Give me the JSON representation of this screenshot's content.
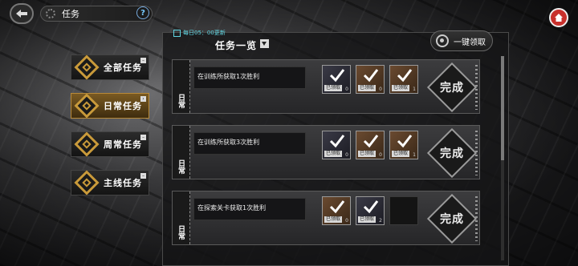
{
  "header": {
    "title": "任务",
    "help_glyph": "?"
  },
  "sidebar": {
    "items": [
      {
        "label": "全部任务",
        "active": false
      },
      {
        "label": "日常任务",
        "active": true
      },
      {
        "label": "周常任务",
        "active": false
      },
      {
        "label": "主线任务",
        "active": false
      }
    ]
  },
  "panel": {
    "refresh_text": "每日05：00更新",
    "title": "任务一览",
    "claim_all_label": "一键领取",
    "card_type": "日常",
    "done_label": "完成",
    "claimed_label": "已领取"
  },
  "tasks": [
    {
      "text": "在训练所获取1次胜利",
      "rewards": [
        {
          "tint": "blue",
          "count": "0"
        },
        {
          "tint": "brown",
          "count": "0"
        },
        {
          "tint": "brown",
          "count": "1"
        }
      ]
    },
    {
      "text": "在训练所获取3次胜利",
      "rewards": [
        {
          "tint": "blue",
          "count": "0"
        },
        {
          "tint": "brown",
          "count": "0"
        },
        {
          "tint": "brown",
          "count": "1"
        }
      ]
    },
    {
      "text": "在探索关卡获取1次胜利",
      "rewards": [
        {
          "tint": "brown",
          "count": "0"
        },
        {
          "tint": "blue",
          "count": "2"
        }
      ]
    }
  ],
  "colors": {
    "accent_gold": "#c99a3a",
    "refresh_cyan": "#5fd4e0",
    "home_red": "#c8302c"
  }
}
